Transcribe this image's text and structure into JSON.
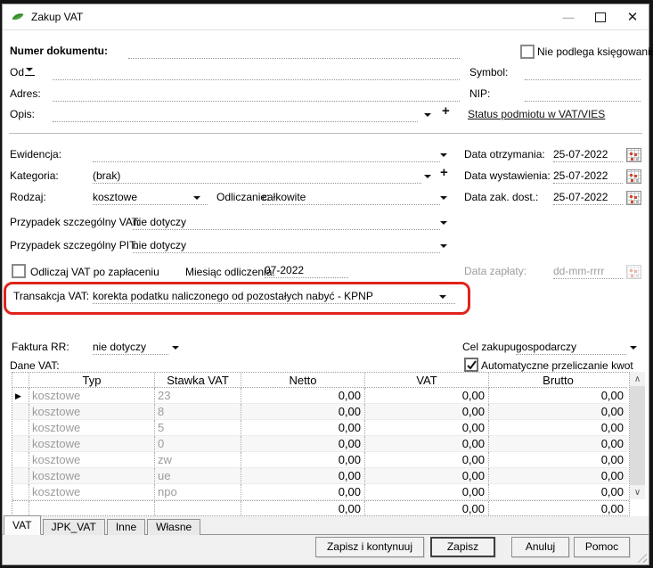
{
  "titlebar": {
    "title": "Zakup VAT"
  },
  "top": {
    "numer_label": "Numer dokumentu:",
    "nie_podlega_label": "Nie podlega księgowaniu",
    "od_label": "Od",
    "symbol_label": "Symbol:",
    "adres_label": "Adres:",
    "nip_label": "NIP:",
    "opis_label": "Opis:",
    "vies_link": "Status podmiotu w VAT/VIES"
  },
  "middle": {
    "ewidencja_label": "Ewidencja:",
    "kategoria_label": "Kategoria:",
    "kategoria_value": "(brak)",
    "rodzaj_label": "Rodzaj:",
    "rodzaj_value": "kosztowe",
    "odliczanie_label": "Odliczanie:",
    "odliczanie_value": "całkowite",
    "przypadek_vat_label": "Przypadek szczególny VAT:",
    "przypadek_vat_value": "nie dotyczy",
    "przypadek_pit_label": "Przypadek szczególny PIT:",
    "przypadek_pit_value": "nie dotyczy",
    "odliczaj_label": "Odliczaj VAT po zapłaceniu",
    "miesiac_label": "Miesiąc odliczenia:",
    "miesiac_value": "07-2022",
    "transakcja_label": "Transakcja VAT:",
    "transakcja_value": "korekta podatku naliczonego od pozostałych nabyć - KPNP",
    "faktura_rr_label": "Faktura RR:",
    "faktura_rr_value": "nie dotyczy"
  },
  "dates": {
    "otrzymania_label": "Data otrzymania:",
    "otrzymania_value": "25-07-2022",
    "wystawienia_label": "Data wystawienia:",
    "wystawienia_value": "25-07-2022",
    "zak_dost_label": "Data zak. dost.:",
    "zak_dost_value": "25-07-2022",
    "zaplaty_label": "Data zapłaty:",
    "zaplaty_placeholder": "dd-mm-rrrr"
  },
  "right": {
    "cel_label": "Cel zakupu:",
    "cel_value": "gospodarczy",
    "auto_przeliczanie_label": "Automatyczne przeliczanie kwot"
  },
  "vat_table": {
    "section_label": "Dane VAT:",
    "headers": [
      "Typ",
      "Stawka VAT",
      "Netto",
      "VAT",
      "Brutto"
    ],
    "rows": [
      {
        "typ": "kosztowe",
        "stawka": "23",
        "netto": "0,00",
        "vat": "0,00",
        "brutto": "0,00"
      },
      {
        "typ": "kosztowe",
        "stawka": "8",
        "netto": "0,00",
        "vat": "0,00",
        "brutto": "0,00"
      },
      {
        "typ": "kosztowe",
        "stawka": "5",
        "netto": "0,00",
        "vat": "0,00",
        "brutto": "0,00"
      },
      {
        "typ": "kosztowe",
        "stawka": "0",
        "netto": "0,00",
        "vat": "0,00",
        "brutto": "0,00"
      },
      {
        "typ": "kosztowe",
        "stawka": "zw",
        "netto": "0,00",
        "vat": "0,00",
        "brutto": "0,00"
      },
      {
        "typ": "kosztowe",
        "stawka": "ue",
        "netto": "0,00",
        "vat": "0,00",
        "brutto": "0,00"
      },
      {
        "typ": "kosztowe",
        "stawka": "npo",
        "netto": "0,00",
        "vat": "0,00",
        "brutto": "0,00"
      }
    ],
    "totals": {
      "netto": "0,00",
      "vat": "0,00",
      "brutto": "0,00"
    }
  },
  "tabs": [
    {
      "label": "VAT"
    },
    {
      "label": "JPK_VAT"
    },
    {
      "label": "Inne"
    },
    {
      "label": "Własne"
    }
  ],
  "buttons": {
    "save_continue": "Zapisz i kontynuuj",
    "save": "Zapisz",
    "cancel": "Anuluj",
    "help": "Pomoc"
  },
  "colors": {
    "annotation_red": "#e0241c",
    "icon_green": "#4aa23c"
  }
}
